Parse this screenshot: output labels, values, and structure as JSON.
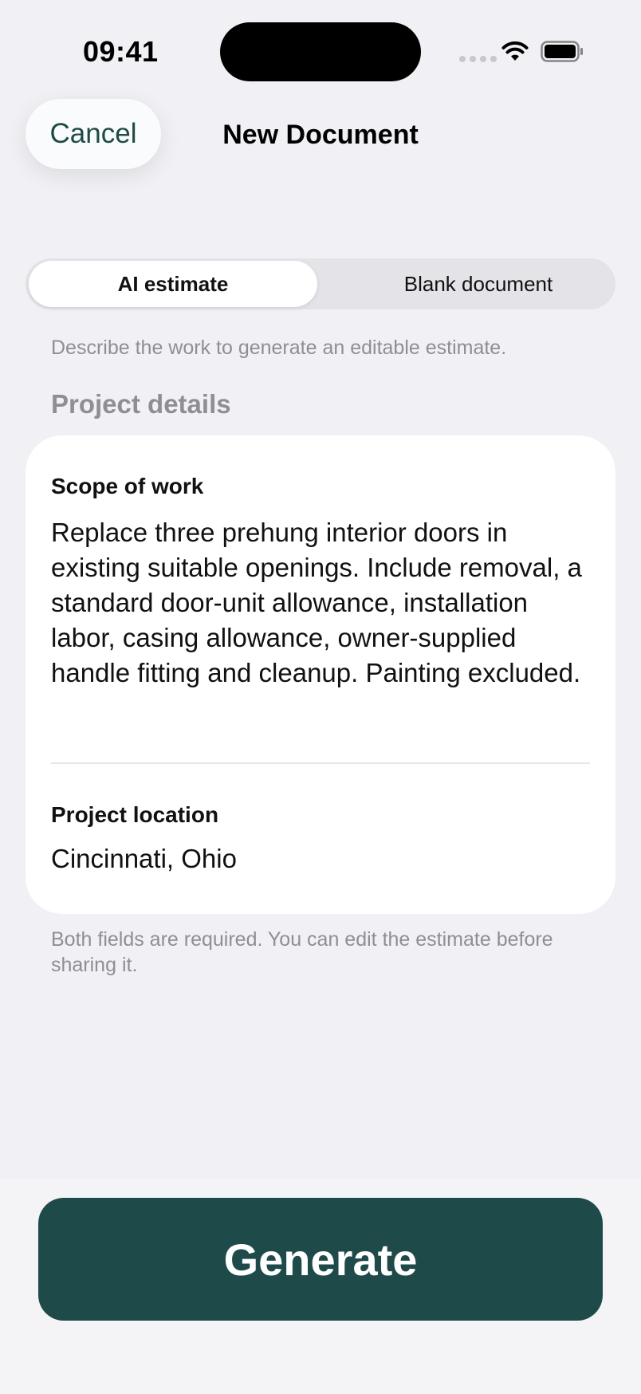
{
  "status_bar": {
    "time": "09:41"
  },
  "nav": {
    "cancel_label": "Cancel",
    "title": "New Document"
  },
  "segmented": {
    "options": [
      "AI estimate",
      "Blank document"
    ],
    "selected": "AI estimate"
  },
  "hint": "Describe the work to generate an editable estimate.",
  "section_title": "Project details",
  "form": {
    "scope_label": "Scope of work",
    "scope_value": "Replace three prehung interior doors in existing suitable openings. Include removal, a standard door-unit allowance, installation labor, casing allowance, owner-supplied handle fitting and cleanup. Painting excluded.",
    "location_label": "Project location",
    "location_value": "Cincinnati, Ohio"
  },
  "footnote": "Both fields are required. You can edit the estimate before sharing it.",
  "generate_label": "Generate",
  "colors": {
    "accent": "#1f4a4a",
    "background": "#f0f0f5",
    "secondary_text": "#8e8e93"
  },
  "icons": [
    "cellular-signal-icon",
    "wifi-icon",
    "battery-icon"
  ]
}
